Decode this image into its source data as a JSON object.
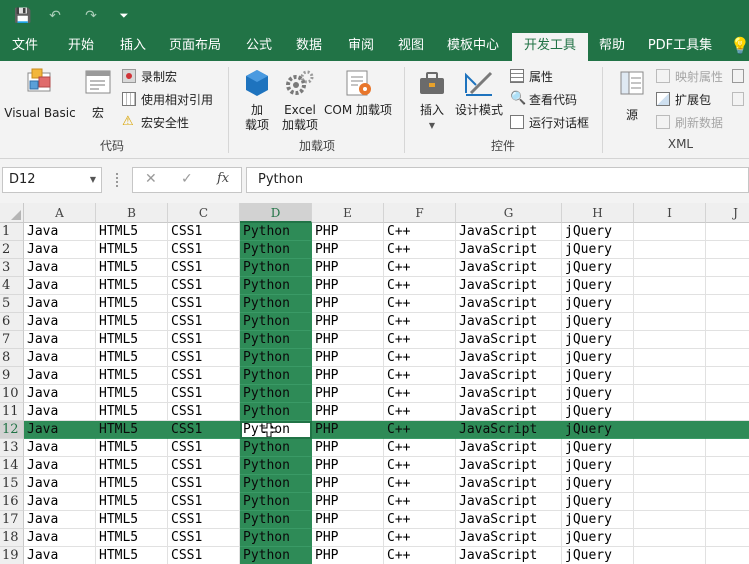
{
  "colors": {
    "accent": "#217346",
    "selection": "#2e8b57"
  },
  "quick_access": {
    "icons": [
      "save-icon",
      "undo-icon",
      "redo-icon",
      "customize-icon"
    ],
    "glyphs": [
      "💾",
      "↶",
      "↷",
      "⏷"
    ]
  },
  "tabs": [
    {
      "label": "文件",
      "active": false
    },
    {
      "label": "开始",
      "active": false
    },
    {
      "label": "插入",
      "active": false
    },
    {
      "label": "页面布局",
      "active": false
    },
    {
      "label": "公式",
      "active": false
    },
    {
      "label": "数据",
      "active": false
    },
    {
      "label": "审阅",
      "active": false
    },
    {
      "label": "视图",
      "active": false
    },
    {
      "label": "模板中心",
      "active": false
    },
    {
      "label": "开发工具",
      "active": true
    },
    {
      "label": "帮助",
      "active": false
    },
    {
      "label": "PDF工具集",
      "active": false
    }
  ],
  "ribbon": {
    "code": {
      "group_label": "代码",
      "visual_basic": "Visual Basic",
      "macro": "宏",
      "record_macro": "录制宏",
      "relative_ref": "使用相对引用",
      "macro_security": "宏安全性"
    },
    "addins": {
      "group_label": "加载项",
      "addins_line1": "加",
      "addins_line2": "载项",
      "excel_addins_line1": "Excel",
      "excel_addins_line2": "加载项",
      "com_addins": "COM 加载项"
    },
    "controls": {
      "group_label": "控件",
      "insert": "插入",
      "design_mode": "设计模式",
      "properties": "属性",
      "view_code": "查看代码",
      "run_dialog": "运行对话框"
    },
    "xml": {
      "group_label": "XML",
      "source": "源",
      "map_properties": "映射属性",
      "expansion_pack": "扩展包",
      "refresh_data": "刷新数据"
    }
  },
  "formula_bar": {
    "name_box": "D12",
    "cancel_glyph": "✕",
    "enter_glyph": "✓",
    "fx_glyph": "fx",
    "value": "Python"
  },
  "sheet": {
    "columns": [
      "A",
      "B",
      "C",
      "D",
      "E",
      "F",
      "G",
      "H",
      "I",
      "J"
    ],
    "selected_column": "D",
    "selected_row": "12",
    "active_cell": "D12",
    "row_numbers": [
      "1",
      "2",
      "3",
      "4",
      "5",
      "6",
      "7",
      "8",
      "9",
      "10",
      "11",
      "12",
      "13",
      "14",
      "15",
      "16",
      "17",
      "18",
      "19"
    ],
    "row_values": [
      "Java",
      "HTML5",
      "CSS1",
      "Python",
      "PHP",
      "C++",
      "JavaScript",
      "jQuery",
      "",
      ""
    ]
  }
}
